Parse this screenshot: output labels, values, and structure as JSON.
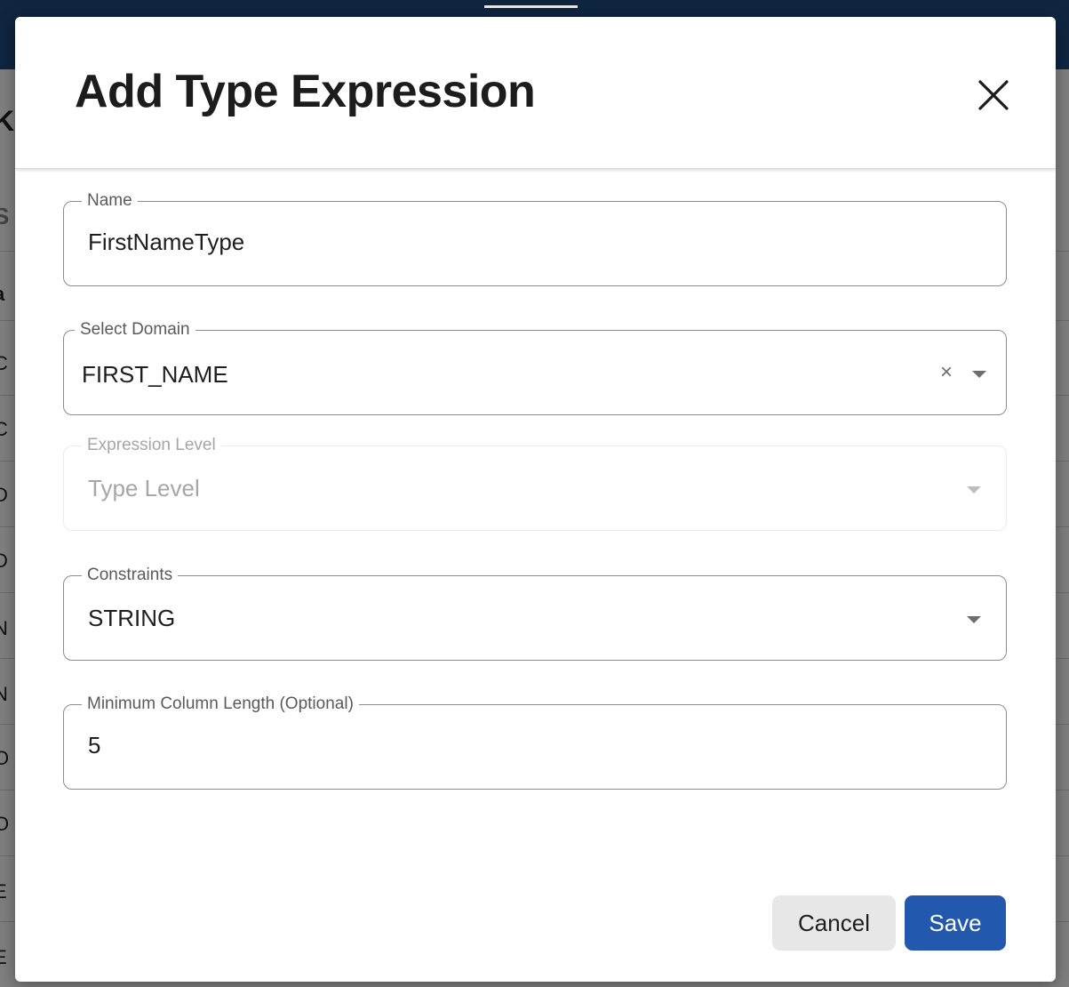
{
  "dialog": {
    "title": "Add Type Expression",
    "close_icon": "close-icon"
  },
  "fields": {
    "name": {
      "label": "Name",
      "value": "FirstNameType"
    },
    "domain": {
      "label": "Select Domain",
      "value": "FIRST_NAME",
      "clear_symbol": "×"
    },
    "expression_level": {
      "label": "Expression Level",
      "value": "Type Level",
      "disabled": true
    },
    "constraints": {
      "label": "Constraints",
      "value": "STRING"
    },
    "min_length": {
      "label": "Minimum Column Length (Optional)",
      "value": "5"
    }
  },
  "actions": {
    "cancel_label": "Cancel",
    "save_label": "Save"
  },
  "colors": {
    "primary": "#2259ae",
    "topbar": "#0f2540",
    "cancel_bg": "#e7e7e7"
  }
}
